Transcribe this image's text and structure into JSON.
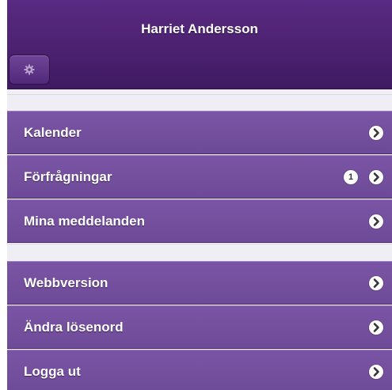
{
  "header": {
    "title": "Harriet Andersson",
    "settings_icon": "gear-icon"
  },
  "menu_groups": [
    {
      "items": [
        {
          "label": "Kalender",
          "icon": "chevron-right-icon"
        },
        {
          "label": "Förfrågningar",
          "badge": "1",
          "icon": "chevron-right-icon"
        },
        {
          "label": "Mina meddelanden",
          "icon": "chevron-right-icon"
        }
      ]
    },
    {
      "items": [
        {
          "label": "Webbversion",
          "icon": "chevron-right-icon"
        },
        {
          "label": "Ändra lösenord",
          "icon": "chevron-right-icon"
        },
        {
          "label": "Logga ut",
          "icon": "chevron-right-icon"
        }
      ]
    }
  ],
  "colors": {
    "header": "#4a2070",
    "item": "#7450a0",
    "spacer": "#eeeef4"
  }
}
